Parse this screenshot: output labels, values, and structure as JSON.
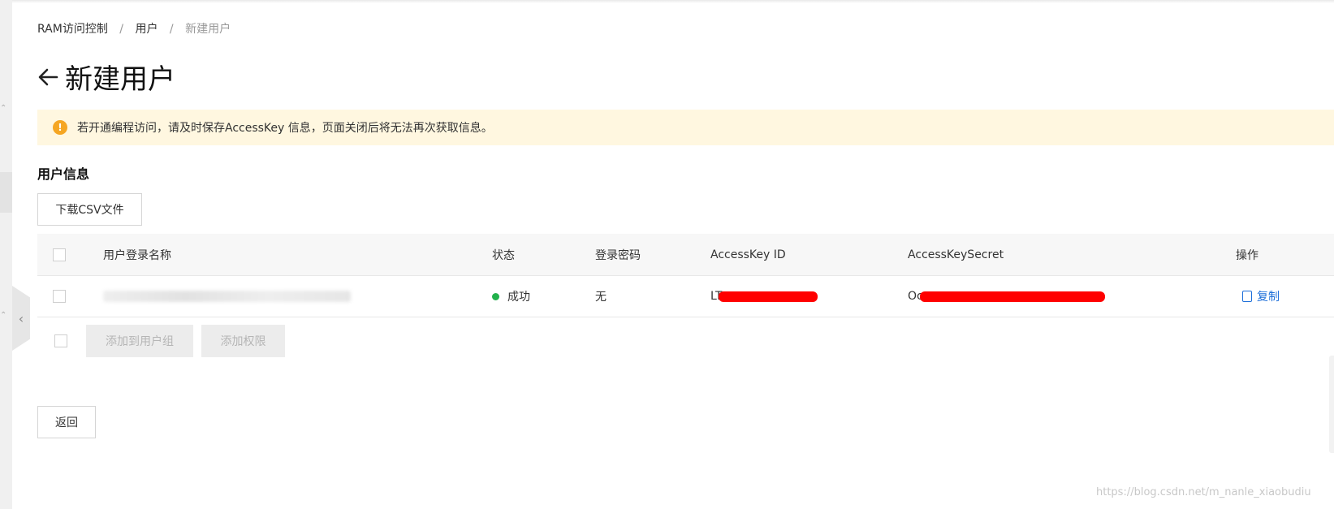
{
  "breadcrumb": {
    "items": [
      "RAM访问控制",
      "用户"
    ],
    "separator": "/",
    "current": "新建用户"
  },
  "page": {
    "title": "新建用户"
  },
  "alert": {
    "text": "若开通编程访问，请及时保存AccessKey 信息，页面关闭后将无法再次获取信息。",
    "icon": "!"
  },
  "section": {
    "title": "用户信息"
  },
  "toolbar": {
    "download_csv": "下载CSV文件"
  },
  "table": {
    "headers": {
      "login_name": "用户登录名称",
      "status": "状态",
      "password": "登录密码",
      "access_key_id": "AccessKey ID",
      "access_key_secret": "AccessKeySecret",
      "actions": "操作"
    },
    "rows": [
      {
        "status": "成功",
        "password": "无",
        "access_key_id_prefix": "LT",
        "access_key_secret_prefix": "Oc",
        "action_copy": "复制"
      }
    ]
  },
  "footer_actions": {
    "add_to_group": "添加到用户组",
    "add_permission": "添加权限"
  },
  "back_button": "返回",
  "watermark": "https://blog.csdn.net/m_nanle_xiaobudiu",
  "colors": {
    "alert_bg": "#fff7e0",
    "alert_icon": "#f5a623",
    "status_success": "#22b14c",
    "link": "#1e6fd9",
    "redaction": "#ff0000"
  }
}
